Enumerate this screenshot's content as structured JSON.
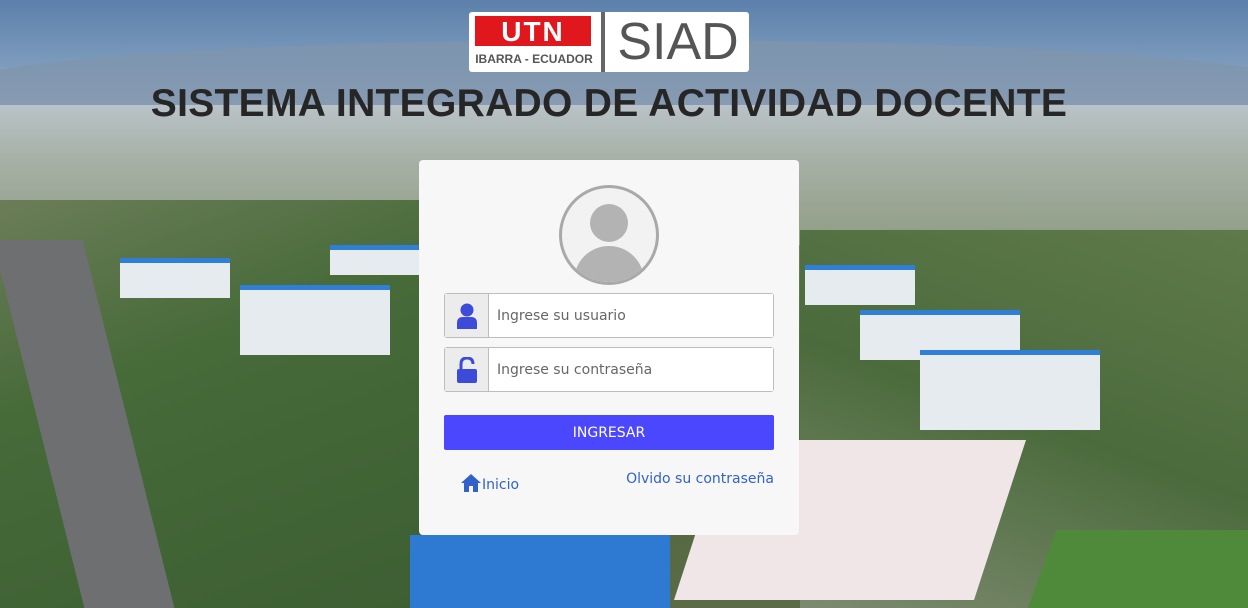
{
  "logo": {
    "brand": "UTN",
    "location": "IBARRA - ECUADOR",
    "system_short": "SIAD"
  },
  "title": "SISTEMA INTEGRADO DE ACTIVIDAD DOCENTE",
  "login": {
    "user_placeholder": "Ingrese su usuario",
    "password_placeholder": "Ingrese su contraseña",
    "submit_label": "INGRESAR",
    "home_link": "Inicio",
    "forgot_link": "Olvido su contraseña"
  },
  "colors": {
    "brand_red": "#e0171c",
    "primary_button": "#4a47ff",
    "link": "#3262c9",
    "icon_blue": "#3d4bd9"
  },
  "icons": {
    "user": "user-icon",
    "password": "unlock-icon",
    "home": "home-icon",
    "avatar": "user-avatar-icon"
  }
}
